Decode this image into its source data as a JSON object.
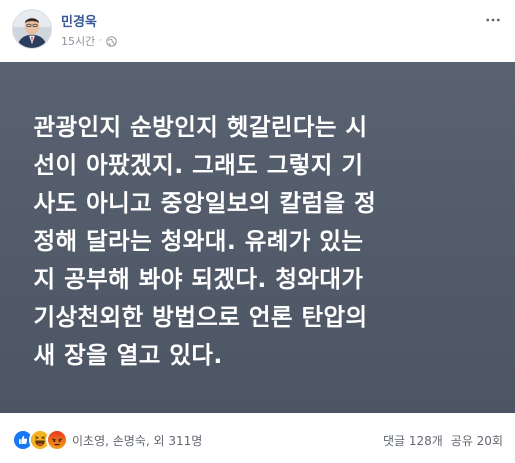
{
  "post": {
    "author_name": "민경욱",
    "time": "15시간",
    "separator": "·",
    "privacy_icon": "globe-icon",
    "more_icon": "more-options-icon",
    "text": "관광인지 순방인지 헷갈린다는 시\n선이 아팠겠지. 그래도 그렇지 기\n사도 아니고 중앙일보의 칼럼을 정\n정해 달라는 청와대. 유례가 있는\n지 공부해 봐야 되겠다. 청와대가\n기상천외한 방법으로 언론 탄압의\n새 장을 열고 있다.",
    "background_color": "#505967"
  },
  "footer": {
    "reaction_icons": [
      "like-icon",
      "haha-icon",
      "angry-icon"
    ],
    "reactors": "이초영, 손명숙, 외 311명",
    "comments": "댓글 128개",
    "shares": "공유 20회"
  },
  "colors": {
    "link_blue": "#385898",
    "like_blue": "#1877f2",
    "haha_yellow": "#f7b125",
    "angry_orange": "#e9710f"
  }
}
